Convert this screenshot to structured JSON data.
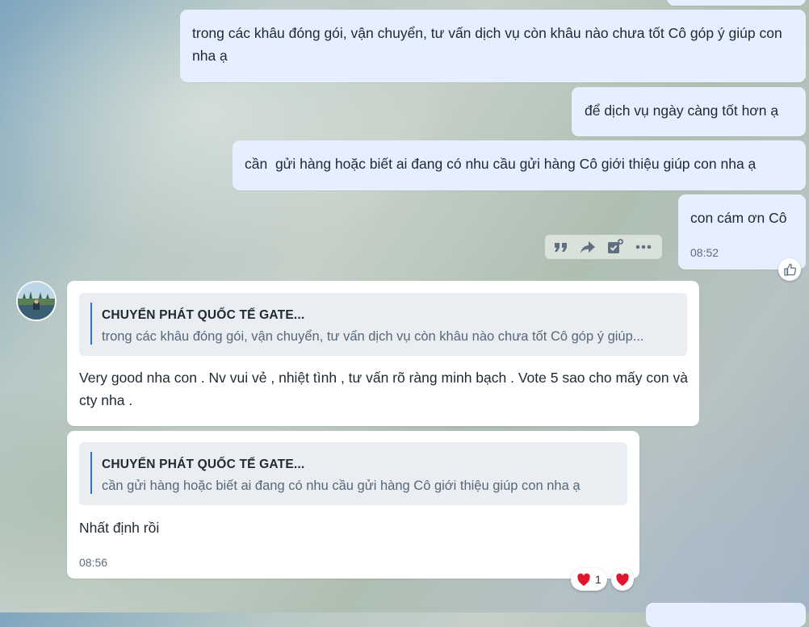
{
  "messages_out": [
    {
      "text": "trong các khâu đóng gói, vận chuyển, tư vấn dịch vụ còn khâu nào chưa tốt Cô góp ý giúp con nha ạ"
    },
    {
      "text": "để dịch vụ ngày càng tốt hơn ạ"
    },
    {
      "text": "cần  gửi hàng hoặc biết ai đang có nhu cầu gửi hàng Cô giới thiệu giúp con nha ạ"
    },
    {
      "text": "con cám ơn Cô",
      "time": "08:52"
    }
  ],
  "messages_in": [
    {
      "quote_title": "CHUYỂN PHÁT QUỐC TẾ GATE...",
      "quote_text": "trong các khâu đóng gói, vận chuyển, tư vấn dịch vụ còn khâu nào chưa tốt Cô góp ý giúp...",
      "text": "Very good nha con . Nv vui vẻ , nhiệt tình , tư vấn rõ ràng minh bạch . Vote 5 sao cho mấy con và cty nha ."
    },
    {
      "quote_title": "CHUYỂN PHÁT QUỐC TẾ GATE...",
      "quote_text": "cần gửi hàng hoặc biết ai đang có nhu cầu gửi hàng Cô giới thiệu giúp con nha ạ",
      "text": "Nhất định rồi",
      "time": "08:56",
      "reaction_count": "1"
    }
  ],
  "toolbar_icons": [
    "quote-icon",
    "forward-icon",
    "add-task-icon",
    "more-icon"
  ],
  "colors": {
    "outgoing_bubble": "#e5efff",
    "incoming_bubble": "#ffffff",
    "quote_bar": "#2e72d9",
    "heart": "#e0162b"
  }
}
